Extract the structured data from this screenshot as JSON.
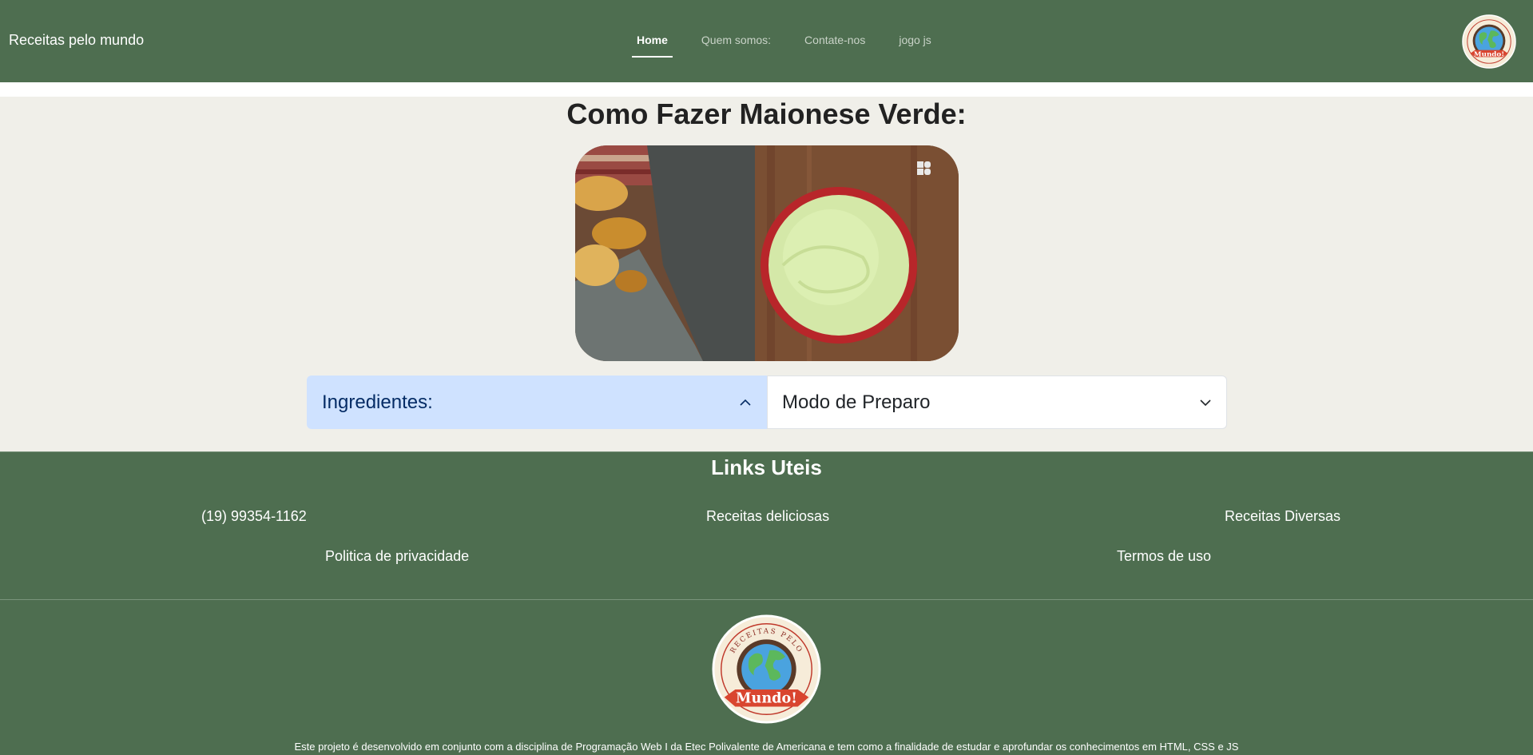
{
  "navbar": {
    "brand": "Receitas pelo mundo",
    "links": [
      {
        "label": "Home",
        "active": true
      },
      {
        "label": "Quem somos:",
        "active": false
      },
      {
        "label": "Contate-nos",
        "active": false
      },
      {
        "label": "jogo js",
        "active": false
      }
    ],
    "logo": {
      "top_text": "RECEITAS PELO",
      "banner_text": "Mundo!"
    }
  },
  "main": {
    "title": "Como Fazer Maionese Verde:",
    "accordion": [
      {
        "label": "Ingredientes:",
        "expanded": true
      },
      {
        "label": "Modo de Preparo",
        "expanded": false
      }
    ]
  },
  "footer": {
    "title": "Links Uteis",
    "links": [
      "(19) 99354-1162",
      "Receitas deliciosas",
      "Receitas Diversas",
      "Politica de privacidade",
      "Termos de uso"
    ],
    "logo": {
      "top_text": "RECEITAS PELO",
      "banner_text": "Mundo!"
    },
    "credit": "Este projeto é desenvolvido em conjunto com a disciplina de Programação Web I da Etec Polivalente de Americana e tem como a finalidade de estudar e aprofundar os conhecimentos em HTML, CSS e JS"
  },
  "colors": {
    "brand_green": "#4e6e50",
    "accordion_active": "#cfe2ff",
    "page_bg": "#f0efe9"
  }
}
